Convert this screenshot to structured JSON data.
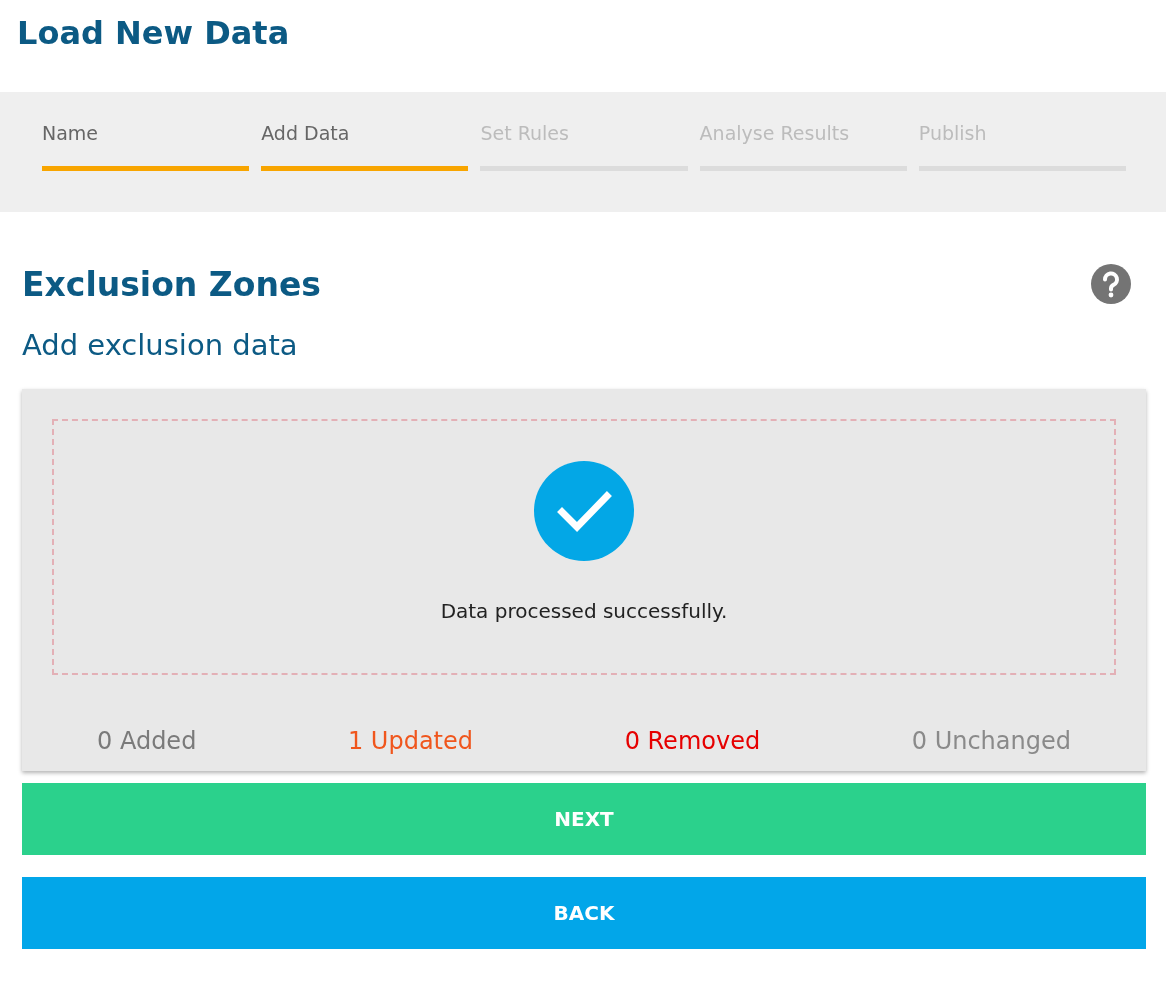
{
  "page": {
    "title": "Load New Data"
  },
  "steps": [
    {
      "label": "Name",
      "completed": true
    },
    {
      "label": "Add Data",
      "completed": true
    },
    {
      "label": "Set Rules",
      "completed": false
    },
    {
      "label": "Analyse Results",
      "completed": false
    },
    {
      "label": "Publish",
      "completed": false
    }
  ],
  "section": {
    "title": "Exclusion Zones",
    "subtitle": "Add exclusion data"
  },
  "upload": {
    "message": "Data processed successfully.",
    "succeeded": true
  },
  "stats": [
    {
      "label": "0 Added",
      "color": "#7a7a7a"
    },
    {
      "label": "1 Updated",
      "color": "#f0561d"
    },
    {
      "label": "0 Removed",
      "color": "#e60000"
    },
    {
      "label": "0 Unchanged",
      "color": "#8a8a8a"
    }
  ],
  "buttons": [
    {
      "label": "NEXT",
      "kind": "primary"
    },
    {
      "label": "BACK",
      "kind": "secondary"
    }
  ]
}
